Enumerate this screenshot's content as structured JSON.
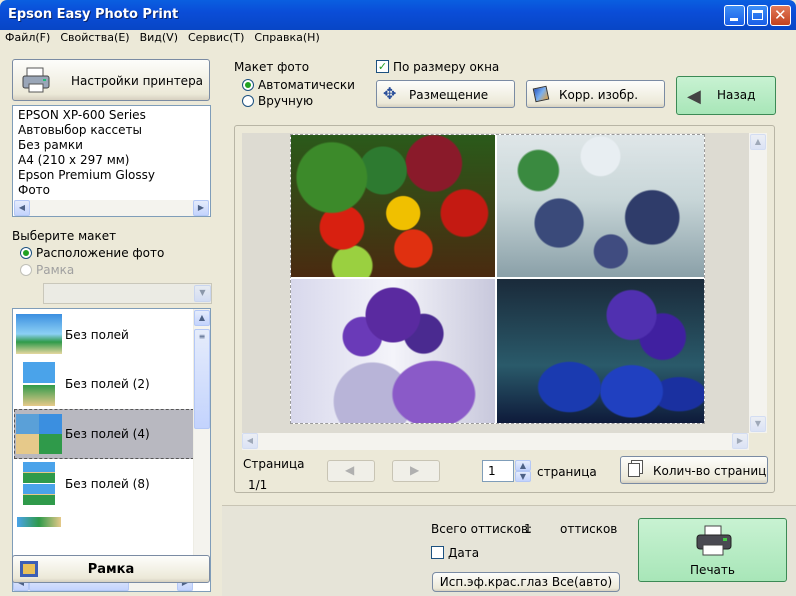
{
  "window": {
    "title": "Epson Easy Photo Print"
  },
  "menu": [
    "Файл(F)",
    "Свойства(E)",
    "Вид(V)",
    "Сервис(T)",
    "Справка(H)"
  ],
  "printer": {
    "settings_label": "Настройки принтера",
    "info": [
      "EPSON XP-600 Series",
      "Автовыбор кассеты",
      "Без рамки",
      "A4 (210 x 297 мм)",
      "Epson Premium Glossy",
      "Фото"
    ]
  },
  "layout_select": {
    "title": "Выберите макет",
    "option_photo": "Расположение фото",
    "option_frame": "Рамка",
    "items": [
      "Без полей",
      "Без полей (2)",
      "Без полей (4)",
      "Без полей (8)"
    ],
    "selected_index": 2
  },
  "frame_button": "Рамка",
  "photo_layout": {
    "title": "Макет фото",
    "auto": "Автоматически",
    "manual": "Вручную",
    "fit_window": "По размеру окна"
  },
  "toolbar": {
    "placement": "Размещение",
    "correct": "Корр. изобр.",
    "back": "Назад"
  },
  "paging": {
    "page_label": "Страница",
    "page_value": "1/1",
    "copies_value": "1",
    "copies_unit": "страница",
    "num_pages_button": "Колич-во страниц"
  },
  "bottom": {
    "total_label": "Всего оттисков:",
    "total_value": "1",
    "total_unit": "оттисков",
    "date_label": "Дата",
    "redeye_button": "Исп.эф.крас.глаз Все(авто)",
    "print_button": "Печать"
  },
  "colors": {
    "title_bar": "#0a4dd8",
    "back_button": "#a8e6b8",
    "print_button": "#a8e6b8",
    "selected_item": "#b8b8c0"
  }
}
